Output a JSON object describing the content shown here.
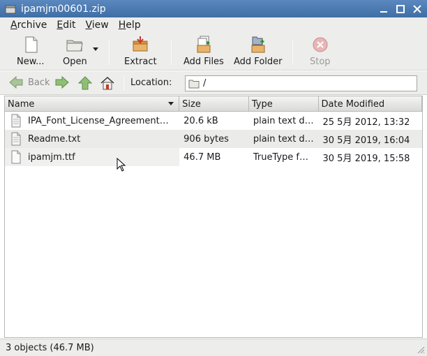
{
  "window": {
    "title": "ipamjm00601.zip"
  },
  "menubar": [
    {
      "label": "Archive",
      "key": "A",
      "rest": "rchive"
    },
    {
      "label": "Edit",
      "key": "E",
      "rest": "dit"
    },
    {
      "label": "View",
      "key": "V",
      "rest": "iew"
    },
    {
      "label": "Help",
      "key": "H",
      "rest": "elp"
    }
  ],
  "toolbar": {
    "new_label": "New...",
    "open_label": "Open",
    "extract_label": "Extract",
    "add_files_label": "Add Files",
    "add_folder_label": "Add Folder",
    "stop_label": "Stop"
  },
  "location": {
    "back_label": "Back",
    "label": "Location:",
    "path": "/"
  },
  "columns": [
    "Name",
    "Size",
    "Type",
    "Date Modified"
  ],
  "files": [
    {
      "name": "IPA_Font_License_Agreement…",
      "size": "20.6 kB",
      "type": "plain text d…",
      "modified": "25 5月 2012, 13:32"
    },
    {
      "name": "Readme.txt",
      "size": "906 bytes",
      "type": "plain text d…",
      "modified": "30 5月 2019, 16:04"
    },
    {
      "name": "ipamjm.ttf",
      "size": "46.7 MB",
      "type": "TrueType f…",
      "modified": "30 5月 2019, 15:58"
    }
  ],
  "status": {
    "text": "3 objects (46.7 MB)"
  },
  "colors": {
    "titlebar": "#4a7ab3",
    "chrome": "#ededec",
    "row_alt": "#ebebea"
  }
}
